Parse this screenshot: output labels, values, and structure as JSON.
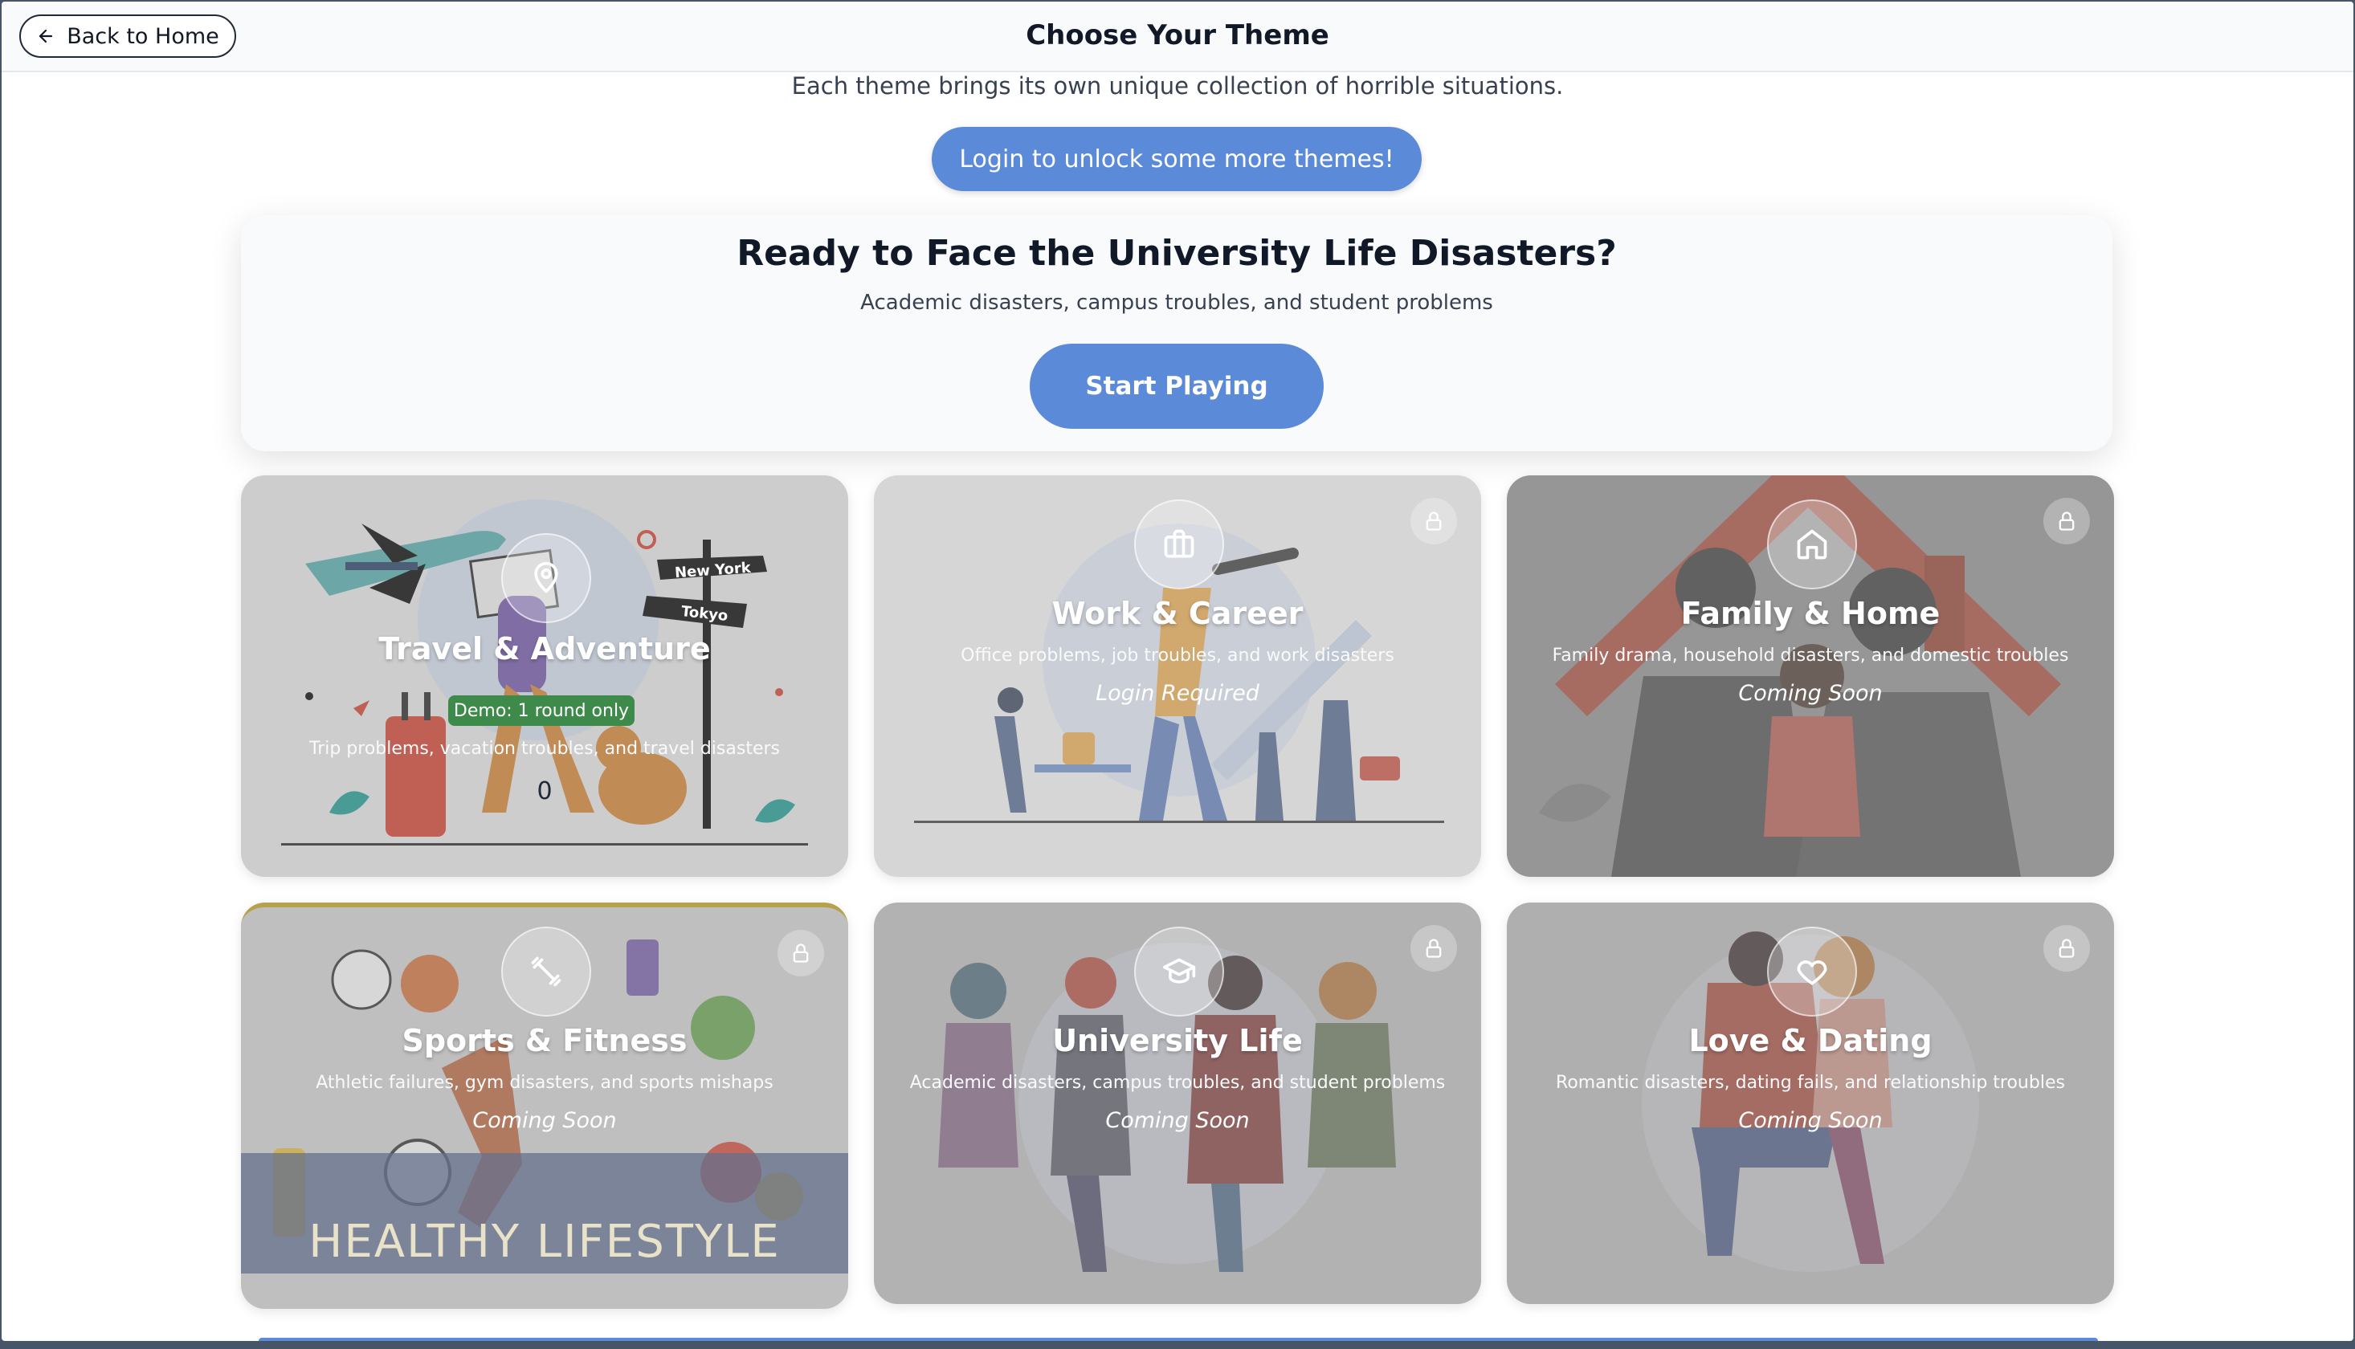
{
  "header": {
    "back_label": "Back to Home",
    "title": "Choose Your Theme"
  },
  "intro": {
    "text": "Each theme brings its own unique collection of horrible situations.",
    "login_button": "Login to unlock some more themes!"
  },
  "ready": {
    "title": "Ready to Face the University Life Disasters?",
    "subtitle": "Academic disasters, campus troubles, and student problems",
    "start_button": "Start Playing"
  },
  "themes": [
    {
      "title": "Travel & Adventure",
      "description": "Trip problems, vacation troubles, and travel disasters",
      "badge": "Demo: 1 round only",
      "count": "0",
      "icon": "map-pin-icon",
      "locked": false,
      "sign_labels": [
        "New York",
        "Tokyo"
      ]
    },
    {
      "title": "Work & Career",
      "description": "Office problems, job troubles, and work disasters",
      "status": "Login Required",
      "icon": "briefcase-icon",
      "locked": true
    },
    {
      "title": "Family & Home",
      "description": "Family drama, household disasters, and domestic troubles",
      "status": "Coming Soon",
      "icon": "home-icon",
      "locked": true
    },
    {
      "title": "Sports & Fitness",
      "description": "Athletic failures, gym disasters, and sports mishaps",
      "status": "Coming Soon",
      "icon": "dumbbell-icon",
      "locked": true,
      "banner": "HEALTHY LIFESTYLE"
    },
    {
      "title": "University Life",
      "description": "Academic disasters, campus troubles, and student problems",
      "status": "Coming Soon",
      "icon": "graduation-cap-icon",
      "locked": true
    },
    {
      "title": "Love & Dating",
      "description": "Romantic disasters, dating fails, and relationship troubles",
      "status": "Coming Soon",
      "icon": "heart-icon",
      "locked": true
    }
  ],
  "colors": {
    "primary": "#5b8ad9",
    "demo_badge": "#3e8a4a",
    "card_locked_overlay": "#9ca3af"
  }
}
